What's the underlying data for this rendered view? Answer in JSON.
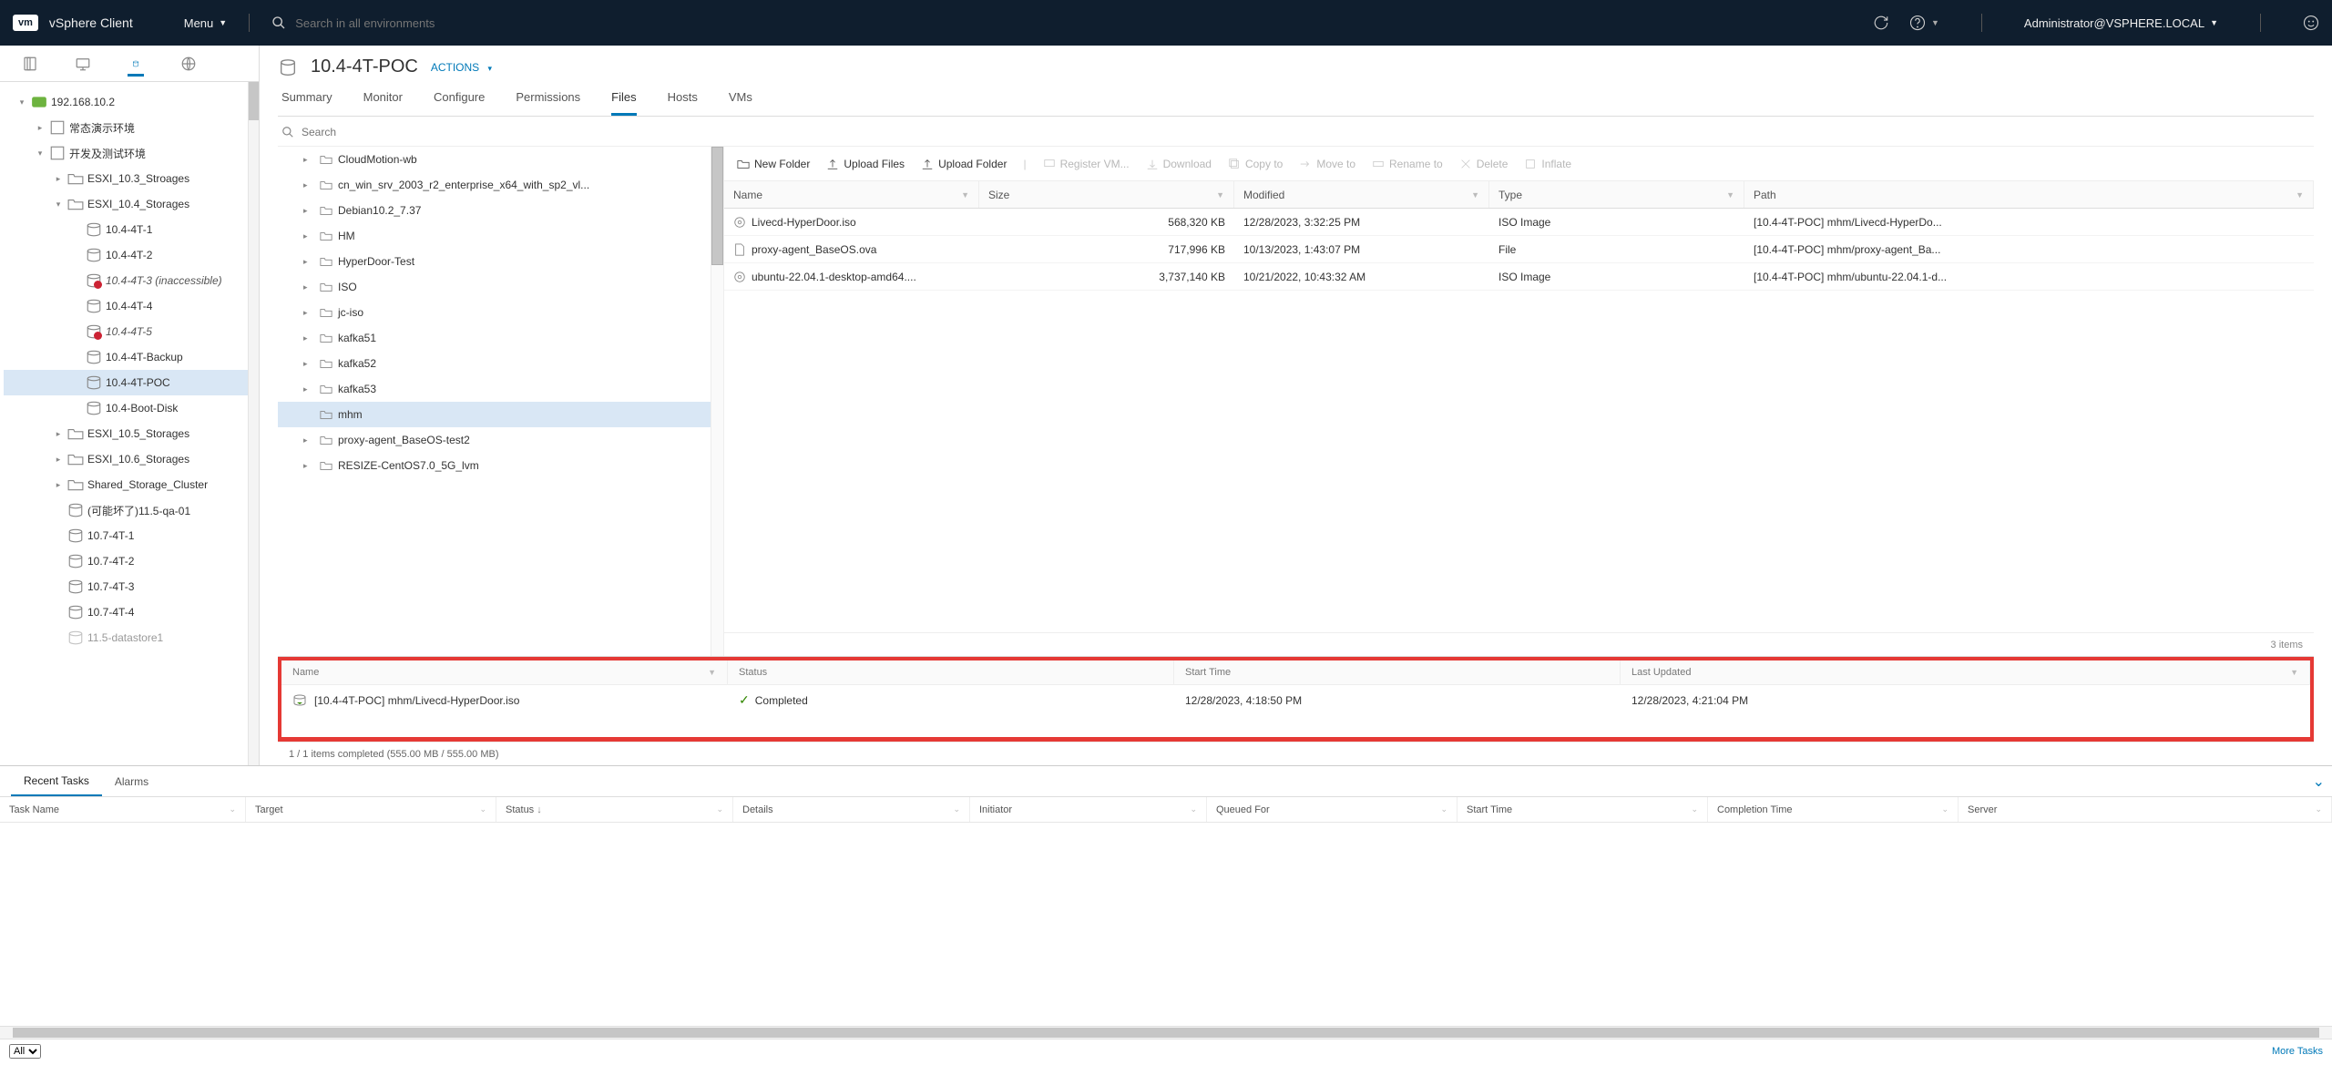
{
  "header": {
    "logo": "vm",
    "app": "vSphere Client",
    "menu": "Menu",
    "search_placeholder": "Search in all environments",
    "user": "Administrator@VSPHERE.LOCAL"
  },
  "sidebar": {
    "root": "192.168.10.2",
    "dc1": "常态演示环境",
    "dc2": "开发及测试环境",
    "cl_103": "ESXI_10.3_Stroages",
    "cl_104": "ESXI_10.4_Storages",
    "ds": {
      "d1": "10.4-4T-1",
      "d2": "10.4-4T-2",
      "d3": "10.4-4T-3 (inaccessible)",
      "d4": "10.4-4T-4",
      "d5": "10.4-4T-5",
      "d6": "10.4-4T-Backup",
      "d7": "10.4-4T-POC",
      "d8": "10.4-Boot-Disk"
    },
    "cl_105": "ESXI_10.5_Storages",
    "cl_106": "ESXI_10.6_Storages",
    "cl_sh": "Shared_Storage_Cluster",
    "ds_extra": {
      "e1": "(可能坏了)11.5-qa-01",
      "e2": "10.7-4T-1",
      "e3": "10.7-4T-2",
      "e4": "10.7-4T-3",
      "e5": "10.7-4T-4",
      "e6": "11.5-datastore1"
    }
  },
  "content": {
    "title": "10.4-4T-POC",
    "actions": "ACTIONS",
    "tabs": [
      "Summary",
      "Monitor",
      "Configure",
      "Permissions",
      "Files",
      "Hosts",
      "VMs"
    ],
    "active_tab": 4,
    "search_placeholder": "Search",
    "folders": [
      "CloudMotion-wb",
      "cn_win_srv_2003_r2_enterprise_x64_with_sp2_vl...",
      "Debian10.2_7.37",
      "HM",
      "HyperDoor-Test",
      "ISO",
      "jc-iso",
      "kafka51",
      "kafka52",
      "kafka53",
      "mhm",
      "proxy-agent_BaseOS-test2",
      "RESIZE-CentOS7.0_5G_lvm"
    ],
    "selected_folder": 10,
    "toolbar": {
      "new_folder": "New Folder",
      "upload_files": "Upload Files",
      "upload_folder": "Upload Folder",
      "register": "Register VM...",
      "download": "Download",
      "copy": "Copy to",
      "move": "Move to",
      "rename": "Rename to",
      "delete": "Delete",
      "inflate": "Inflate"
    },
    "headers": {
      "name": "Name",
      "size": "Size",
      "modified": "Modified",
      "type": "Type",
      "path": "Path"
    },
    "files": [
      {
        "name": "Livecd-HyperDoor.iso",
        "size": "568,320 KB",
        "mod": "12/28/2023, 3:32:25 PM",
        "type": "ISO Image",
        "path": "[10.4-4T-POC] mhm/Livecd-HyperDo...",
        "ftype": "iso"
      },
      {
        "name": "proxy-agent_BaseOS.ova",
        "size": "717,996 KB",
        "mod": "10/13/2023, 1:43:07 PM",
        "type": "File",
        "path": "[10.4-4T-POC] mhm/proxy-agent_Ba...",
        "ftype": "file"
      },
      {
        "name": "ubuntu-22.04.1-desktop-amd64....",
        "size": "3,737,140 KB",
        "mod": "10/21/2022, 10:43:32 AM",
        "type": "ISO Image",
        "path": "[10.4-4T-POC] mhm/ubuntu-22.04.1-d...",
        "ftype": "iso"
      }
    ],
    "foot": "3 items"
  },
  "upload": {
    "headers": {
      "name": "Name",
      "status": "Status",
      "start": "Start Time",
      "updated": "Last Updated"
    },
    "row": {
      "name": "[10.4-4T-POC] mhm/Livecd-HyperDoor.iso",
      "status": "Completed",
      "start": "12/28/2023, 4:18:50 PM",
      "updated": "12/28/2023, 4:21:04 PM"
    },
    "foot": "1 / 1 items completed (555.00 MB / 555.00 MB)"
  },
  "bottom": {
    "tabs": [
      "Recent Tasks",
      "Alarms"
    ],
    "cols": [
      "Task Name",
      "Target",
      "Status",
      "Details",
      "Initiator",
      "Queued For",
      "Start Time",
      "Completion Time",
      "Server"
    ],
    "filter_all": "All",
    "more": "More Tasks"
  }
}
